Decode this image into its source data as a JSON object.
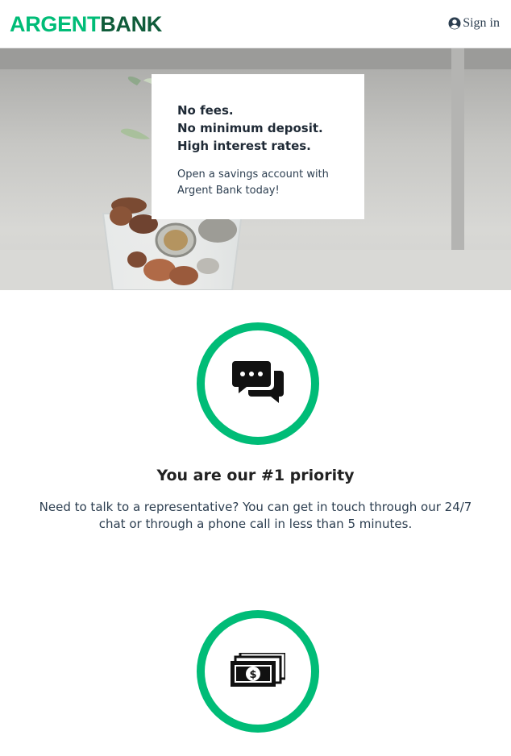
{
  "nav": {
    "logo_part1": "ARGENT",
    "logo_part2": "BANK",
    "signin_label": "Sign in",
    "signin_icon": "user-circle-icon"
  },
  "hero": {
    "subtitles": [
      "No fees.",
      "No minimum deposit.",
      "High interest rates."
    ],
    "text": "Open a savings account with Argent Bank today!"
  },
  "features": [
    {
      "icon": "chat-icon",
      "title": "You are our #1 priority",
      "text": "Need to talk to a representative? You can get in touch through our 24/7 chat or through a phone call in less than 5 minutes."
    },
    {
      "icon": "money-icon"
    }
  ],
  "colors": {
    "brand_green": "#00bc77",
    "brand_dark_green": "#0f5c3a",
    "text": "#2c3e50"
  }
}
